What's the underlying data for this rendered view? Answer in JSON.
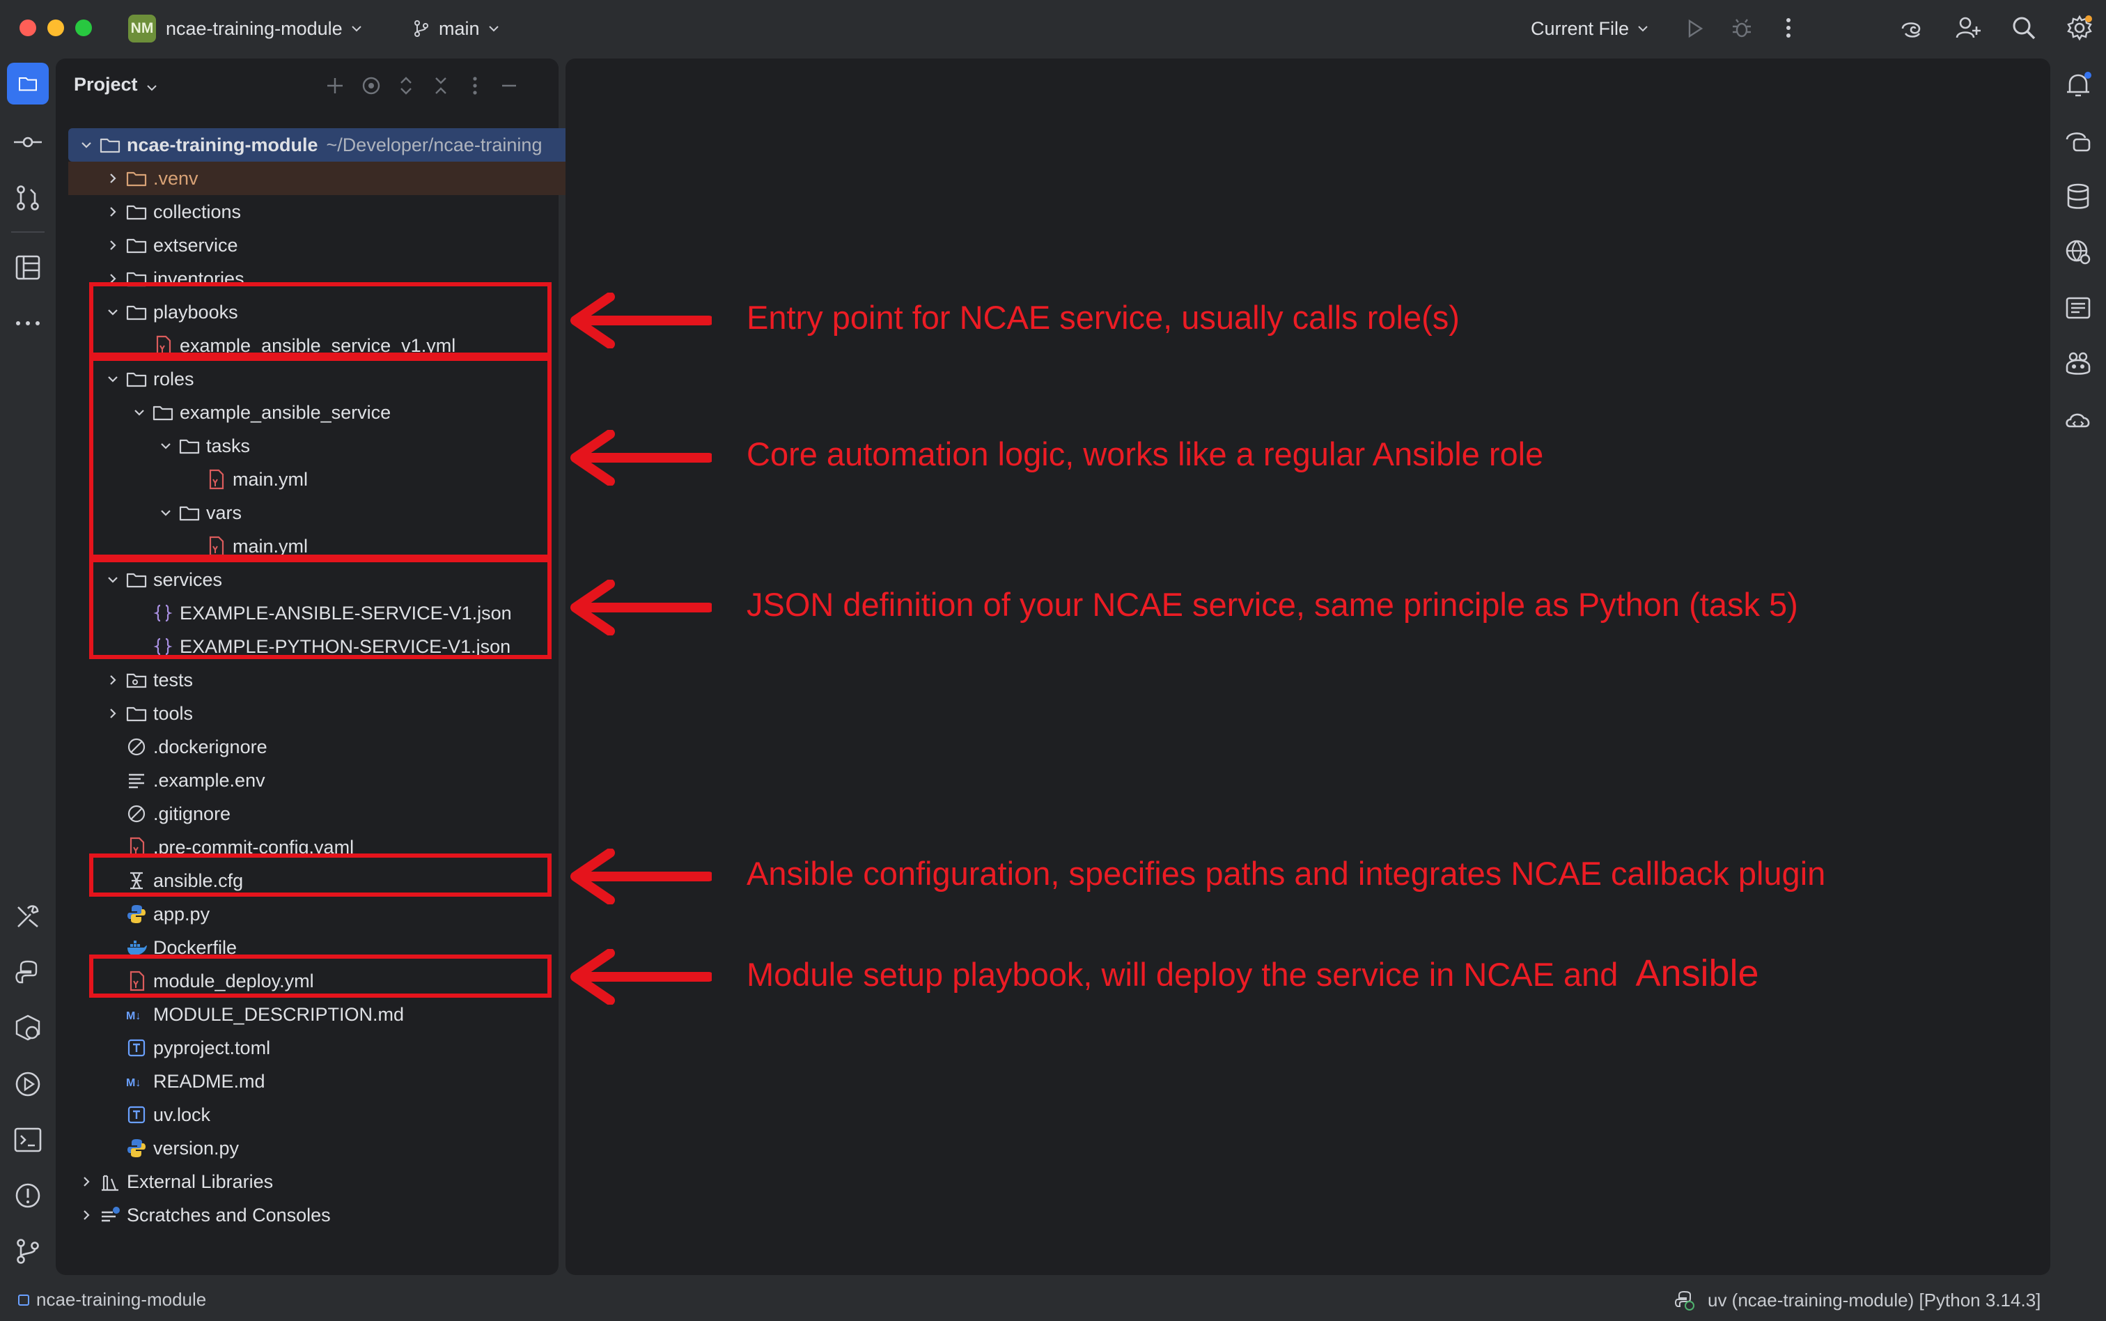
{
  "titlebar": {
    "project_badge": "NM",
    "project_name": "ncae-training-module",
    "branch": "main",
    "run_config": "Current File"
  },
  "project_panel": {
    "title": "Project"
  },
  "tree": [
    {
      "label": "ncae-training-module",
      "path": "~/Developer/ncae-training",
      "kind": "folder",
      "expanded": true,
      "level": 0
    },
    {
      "label": ".venv",
      "kind": "folder",
      "level": 1
    },
    {
      "label": "collections",
      "kind": "folder",
      "level": 1
    },
    {
      "label": "extservice",
      "kind": "folder",
      "level": 1
    },
    {
      "label": "inventories",
      "kind": "folder",
      "level": 1
    },
    {
      "label": "playbooks",
      "kind": "folder",
      "expanded": true,
      "level": 1
    },
    {
      "label": "example_ansible_service_v1.yml",
      "kind": "yaml",
      "level": 2
    },
    {
      "label": "roles",
      "kind": "folder",
      "expanded": true,
      "level": 1
    },
    {
      "label": "example_ansible_service",
      "kind": "folder",
      "expanded": true,
      "level": 2
    },
    {
      "label": "tasks",
      "kind": "folder",
      "expanded": true,
      "level": 3
    },
    {
      "label": "main.yml",
      "kind": "yaml",
      "level": 4
    },
    {
      "label": "vars",
      "kind": "folder",
      "expanded": true,
      "level": 3
    },
    {
      "label": "main.yml",
      "kind": "yaml",
      "level": 4
    },
    {
      "label": "services",
      "kind": "folder",
      "expanded": true,
      "level": 1
    },
    {
      "label": "EXAMPLE-ANSIBLE-SERVICE-V1.json",
      "kind": "json",
      "level": 2
    },
    {
      "label": "EXAMPLE-PYTHON-SERVICE-V1.json",
      "kind": "json",
      "level": 2
    },
    {
      "label": "tests",
      "kind": "folder",
      "level": 1
    },
    {
      "label": "tools",
      "kind": "folder",
      "level": 1
    },
    {
      "label": ".dockerignore",
      "kind": "ignore",
      "level": 1
    },
    {
      "label": ".example.env",
      "kind": "text",
      "level": 1
    },
    {
      "label": ".gitignore",
      "kind": "ignore",
      "level": 1
    },
    {
      "label": ".pre-commit-config.yaml",
      "kind": "yaml",
      "level": 1
    },
    {
      "label": "ansible.cfg",
      "kind": "cfg",
      "level": 1
    },
    {
      "label": "app.py",
      "kind": "python",
      "level": 1
    },
    {
      "label": "Dockerfile",
      "kind": "docker",
      "level": 1
    },
    {
      "label": "module_deploy.yml",
      "kind": "yaml",
      "level": 1
    },
    {
      "label": "MODULE_DESCRIPTION.md",
      "kind": "markdown",
      "level": 1
    },
    {
      "label": "pyproject.toml",
      "kind": "toml",
      "level": 1
    },
    {
      "label": "README.md",
      "kind": "markdown",
      "level": 1
    },
    {
      "label": "uv.lock",
      "kind": "toml",
      "level": 1
    },
    {
      "label": "version.py",
      "kind": "python",
      "level": 1
    },
    {
      "label": "External Libraries",
      "kind": "library",
      "level": 0
    },
    {
      "label": "Scratches and Consoles",
      "kind": "scratches",
      "level": 0
    }
  ],
  "annotations": [
    "Entry point for NCAE service, usually calls role(s)",
    "Core automation logic, works like a regular Ansible role",
    "JSON definition of your NCAE service, same principle as Python (task 5)",
    "Ansible configuration, specifies paths and integrates NCAE callback plugin",
    "Module setup playbook, will deploy the service in NCAE and",
    "Ansible"
  ],
  "statusbar": {
    "project": "ncae-training-module",
    "interpreter": "uv (ncae-training-module) [Python 3.14.3]"
  },
  "colors": {
    "annotation_red": "#e5141c",
    "selection": "#2e436e",
    "panel": "#1e1f22",
    "chrome": "#2b2d30",
    "accent_blue": "#3574f0"
  }
}
